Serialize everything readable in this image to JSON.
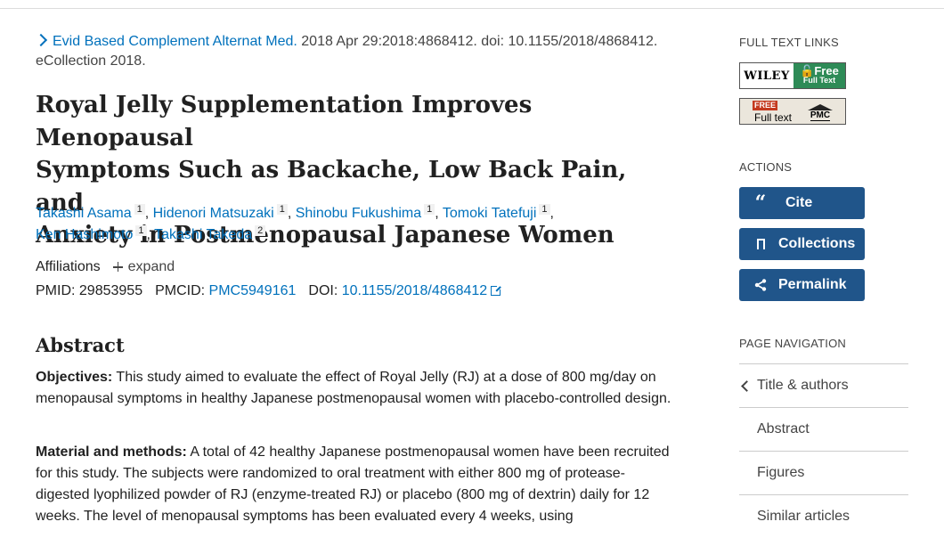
{
  "journal": {
    "name": "Evid Based Complement Alternat Med.",
    "citation": "2018 Apr 29:2018:4868412. doi: 10.1155/2018/4868412.",
    "ecollection": "eCollection 2018."
  },
  "title": {
    "line1": "Royal Jelly Supplementation Improves Menopausal",
    "line2": "Symptoms Such as Backache, Low Back Pain, and",
    "line3": "Anxiety in Postmenopausal Japanese Women"
  },
  "authors": [
    {
      "name": "Takashi Asama",
      "aff": "1"
    },
    {
      "name": "Hidenori Matsuzaki",
      "aff": "1"
    },
    {
      "name": "Shinobu Fukushima",
      "aff": "1"
    },
    {
      "name": "Tomoki Tatefuji",
      "aff": "1"
    },
    {
      "name": "Ken Hashimoto",
      "aff": "1"
    },
    {
      "name": "Takashi Takeda",
      "aff": "2"
    }
  ],
  "affiliations": {
    "label": "Affiliations",
    "expand": "expand"
  },
  "ids": {
    "pmid_label": "PMID:",
    "pmid": "29853955",
    "pmcid_label": "PMCID:",
    "pmcid": "PMC5949161",
    "doi_label": "DOI:",
    "doi": "10.1155/2018/4868412"
  },
  "abstract": {
    "heading": "Abstract",
    "objectives_label": "Objectives:",
    "objectives_text": "This study aimed to evaluate the effect of Royal Jelly (RJ) at a dose of 800 mg/day on menopausal symptoms in healthy Japanese postmenopausal women with placebo-controlled design.",
    "methods_label": "Material and methods:",
    "methods_text": "A total of 42 healthy Japanese postmenopausal women have been recruited for this study. The subjects were randomized to oral treatment with either 800 mg of protease-digested lyophilized powder of RJ (enzyme-treated RJ) or placebo (800 mg of dextrin) daily for 12 weeks. The level of menopausal symptoms has been evaluated every 4 weeks, using"
  },
  "sidebar": {
    "full_text_heading": "FULL TEXT LINKS",
    "wiley": {
      "brand": "WILEY",
      "free": "Free",
      "full_text": "Full Text"
    },
    "pmc": {
      "free": "FREE",
      "full_text": "Full text",
      "brand": "PMC"
    },
    "actions_heading": "ACTIONS",
    "actions": {
      "cite": "Cite",
      "collections": "Collections",
      "permalink": "Permalink"
    },
    "page_nav_heading": "PAGE NAVIGATION",
    "nav": {
      "title_authors": "Title & authors",
      "abstract": "Abstract",
      "figures": "Figures",
      "similar": "Similar articles"
    }
  }
}
